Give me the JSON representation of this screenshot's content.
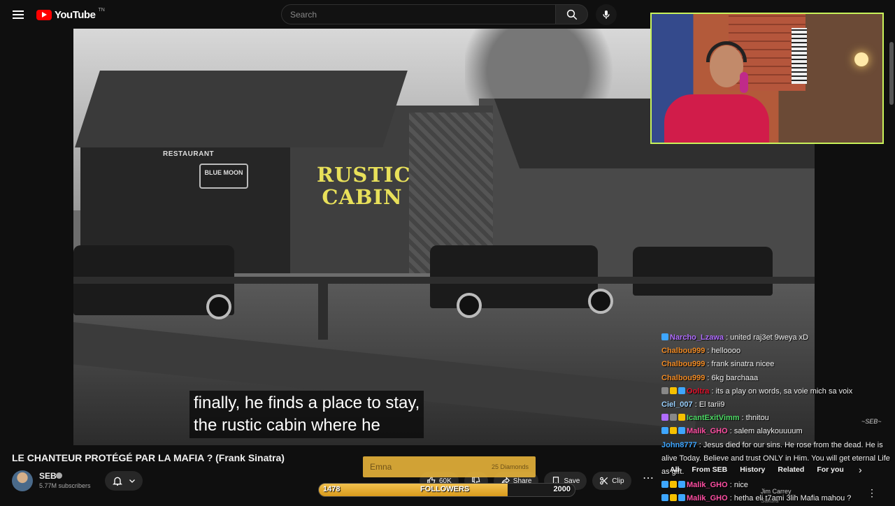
{
  "header": {
    "logo_text": "YouTube",
    "logo_tm": "TN",
    "search_placeholder": "Search"
  },
  "video": {
    "sign_main_line1": "RUSTIC",
    "sign_main_line2": "CABIN",
    "sign_restaurant": "RESTAURANT",
    "sign_bluemoon": "BLUE MOON",
    "subtitle_line1": "finally, he finds a place to stay,",
    "subtitle_line2": "the rustic cabin where he"
  },
  "chat": [
    {
      "user": "Narcho_Lzawa",
      "user_color": "#b06cff",
      "text": " : united raj3et 9weya xD",
      "badges": [
        "#3ea6ff"
      ]
    },
    {
      "user": "Chalbou999",
      "user_color": "#f08a24",
      "text": " : helloooo",
      "badges": []
    },
    {
      "user": "Chalbou999",
      "user_color": "#f08a24",
      "text": " : frank sinatra nicee",
      "badges": []
    },
    {
      "user": "Chalbou999",
      "user_color": "#f08a24",
      "text": " : 6kg barchaaa",
      "badges": []
    },
    {
      "user": "Ooltra",
      "user_color": "#e0102a",
      "text": " : its a play on words, sa voie mich sa voix",
      "badges": [
        "#888",
        "#f5c000",
        "#3ea6ff"
      ]
    },
    {
      "user": "Ciel_007",
      "user_color": "#9ad1ff",
      "text": " : El tarii9",
      "badges": []
    },
    {
      "user": "IcantExitVimm",
      "user_color": "#4cd964",
      "text": " : thnitou",
      "badges": [
        "#b06cff",
        "#888",
        "#f5c000"
      ]
    },
    {
      "user": "Malik_GHO",
      "user_color": "#ff4fa3",
      "text": " : salem alaykouuuum",
      "badges": [
        "#3ea6ff",
        "#f5c000",
        "#3ea6ff"
      ]
    },
    {
      "user": "John8777",
      "user_color": "#3ea6ff",
      "text": " : Jesus died for our sins. He rose from the dead. He is alive Today. Believe and trust ONLY in Him. You will get eternal Life as gift.",
      "badges": []
    },
    {
      "user": "Malik_GHO",
      "user_color": "#ff4fa3",
      "text": " : nice",
      "badges": [
        "#3ea6ff",
        "#f5c000",
        "#3ea6ff"
      ]
    },
    {
      "user": "Malik_GHO",
      "user_color": "#ff4fa3",
      "text": " : hetha eli t7ami 3lih Mafia mahou ?",
      "badges": [
        "#3ea6ff",
        "#f5c000",
        "#3ea6ff"
      ]
    }
  ],
  "info": {
    "title": "LE CHANTEUR PROTÉGÉ PAR LA MAFIA ? (Frank Sinatra)",
    "channel": "SEB",
    "subscribers": "5.77M subscribers",
    "likes": "60K",
    "share": "Share",
    "save": "Save",
    "clip": "Clip",
    "more": "⋯"
  },
  "goal": {
    "input_placeholder": "Emna",
    "input_right": "25 Diamonds",
    "current": "1478",
    "label": "FOLLOWERS",
    "target": "2000",
    "fill_fraction": 0.739
  },
  "related": {
    "chips": [
      "All",
      "From SEB",
      "History",
      "Related",
      "For you"
    ],
    "video_title": "Jim Carrey",
    "video_sub": "Sakura"
  },
  "colors": {
    "accent_red": "#ff0000",
    "webcam_border": "#c8f25a",
    "goal_fill": "#f2c14e"
  }
}
